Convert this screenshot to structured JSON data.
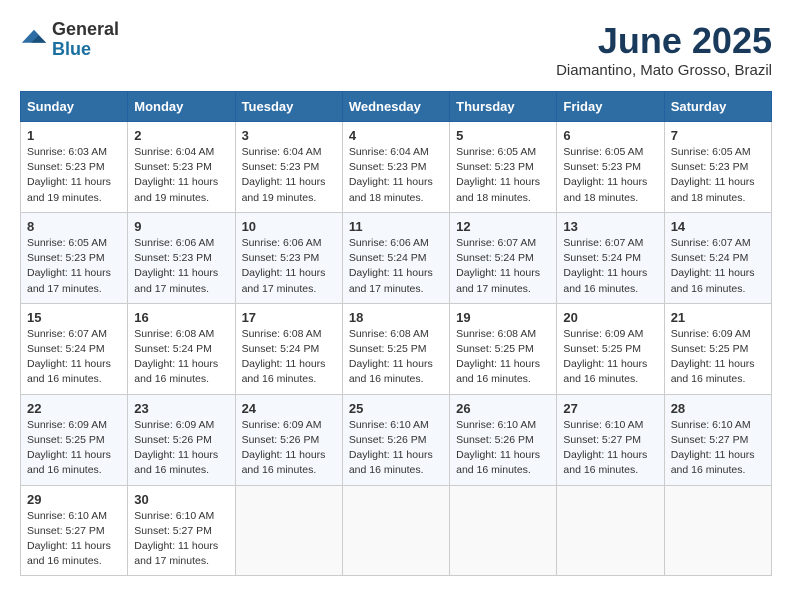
{
  "header": {
    "logo_general": "General",
    "logo_blue": "Blue",
    "title": "June 2025",
    "location": "Diamantino, Mato Grosso, Brazil"
  },
  "weekdays": [
    "Sunday",
    "Monday",
    "Tuesday",
    "Wednesday",
    "Thursday",
    "Friday",
    "Saturday"
  ],
  "weeks": [
    [
      {
        "day": "1",
        "sunrise": "6:03 AM",
        "sunset": "5:23 PM",
        "daylight": "11 hours and 19 minutes."
      },
      {
        "day": "2",
        "sunrise": "6:04 AM",
        "sunset": "5:23 PM",
        "daylight": "11 hours and 19 minutes."
      },
      {
        "day": "3",
        "sunrise": "6:04 AM",
        "sunset": "5:23 PM",
        "daylight": "11 hours and 19 minutes."
      },
      {
        "day": "4",
        "sunrise": "6:04 AM",
        "sunset": "5:23 PM",
        "daylight": "11 hours and 18 minutes."
      },
      {
        "day": "5",
        "sunrise": "6:05 AM",
        "sunset": "5:23 PM",
        "daylight": "11 hours and 18 minutes."
      },
      {
        "day": "6",
        "sunrise": "6:05 AM",
        "sunset": "5:23 PM",
        "daylight": "11 hours and 18 minutes."
      },
      {
        "day": "7",
        "sunrise": "6:05 AM",
        "sunset": "5:23 PM",
        "daylight": "11 hours and 18 minutes."
      }
    ],
    [
      {
        "day": "8",
        "sunrise": "6:05 AM",
        "sunset": "5:23 PM",
        "daylight": "11 hours and 17 minutes."
      },
      {
        "day": "9",
        "sunrise": "6:06 AM",
        "sunset": "5:23 PM",
        "daylight": "11 hours and 17 minutes."
      },
      {
        "day": "10",
        "sunrise": "6:06 AM",
        "sunset": "5:23 PM",
        "daylight": "11 hours and 17 minutes."
      },
      {
        "day": "11",
        "sunrise": "6:06 AM",
        "sunset": "5:24 PM",
        "daylight": "11 hours and 17 minutes."
      },
      {
        "day": "12",
        "sunrise": "6:07 AM",
        "sunset": "5:24 PM",
        "daylight": "11 hours and 17 minutes."
      },
      {
        "day": "13",
        "sunrise": "6:07 AM",
        "sunset": "5:24 PM",
        "daylight": "11 hours and 16 minutes."
      },
      {
        "day": "14",
        "sunrise": "6:07 AM",
        "sunset": "5:24 PM",
        "daylight": "11 hours and 16 minutes."
      }
    ],
    [
      {
        "day": "15",
        "sunrise": "6:07 AM",
        "sunset": "5:24 PM",
        "daylight": "11 hours and 16 minutes."
      },
      {
        "day": "16",
        "sunrise": "6:08 AM",
        "sunset": "5:24 PM",
        "daylight": "11 hours and 16 minutes."
      },
      {
        "day": "17",
        "sunrise": "6:08 AM",
        "sunset": "5:24 PM",
        "daylight": "11 hours and 16 minutes."
      },
      {
        "day": "18",
        "sunrise": "6:08 AM",
        "sunset": "5:25 PM",
        "daylight": "11 hours and 16 minutes."
      },
      {
        "day": "19",
        "sunrise": "6:08 AM",
        "sunset": "5:25 PM",
        "daylight": "11 hours and 16 minutes."
      },
      {
        "day": "20",
        "sunrise": "6:09 AM",
        "sunset": "5:25 PM",
        "daylight": "11 hours and 16 minutes."
      },
      {
        "day": "21",
        "sunrise": "6:09 AM",
        "sunset": "5:25 PM",
        "daylight": "11 hours and 16 minutes."
      }
    ],
    [
      {
        "day": "22",
        "sunrise": "6:09 AM",
        "sunset": "5:25 PM",
        "daylight": "11 hours and 16 minutes."
      },
      {
        "day": "23",
        "sunrise": "6:09 AM",
        "sunset": "5:26 PM",
        "daylight": "11 hours and 16 minutes."
      },
      {
        "day": "24",
        "sunrise": "6:09 AM",
        "sunset": "5:26 PM",
        "daylight": "11 hours and 16 minutes."
      },
      {
        "day": "25",
        "sunrise": "6:10 AM",
        "sunset": "5:26 PM",
        "daylight": "11 hours and 16 minutes."
      },
      {
        "day": "26",
        "sunrise": "6:10 AM",
        "sunset": "5:26 PM",
        "daylight": "11 hours and 16 minutes."
      },
      {
        "day": "27",
        "sunrise": "6:10 AM",
        "sunset": "5:27 PM",
        "daylight": "11 hours and 16 minutes."
      },
      {
        "day": "28",
        "sunrise": "6:10 AM",
        "sunset": "5:27 PM",
        "daylight": "11 hours and 16 minutes."
      }
    ],
    [
      {
        "day": "29",
        "sunrise": "6:10 AM",
        "sunset": "5:27 PM",
        "daylight": "11 hours and 16 minutes."
      },
      {
        "day": "30",
        "sunrise": "6:10 AM",
        "sunset": "5:27 PM",
        "daylight": "11 hours and 17 minutes."
      },
      null,
      null,
      null,
      null,
      null
    ]
  ]
}
